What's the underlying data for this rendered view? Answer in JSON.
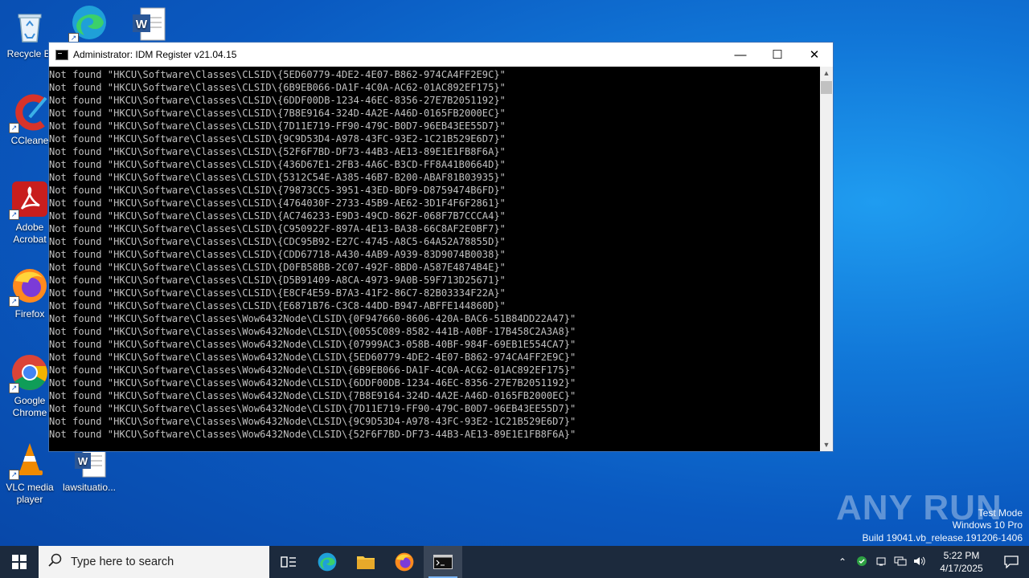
{
  "desktop": {
    "icons": [
      {
        "label": "Recycle Bin",
        "name": "recycle-bin"
      },
      {
        "label": "Microsoft Edge",
        "name": "edge"
      },
      {
        "label": "Word document",
        "name": "word-doc-top"
      },
      {
        "label": "CCleaner",
        "name": "ccleaner"
      },
      {
        "label": "Adobe Acrobat",
        "name": "adobe-acrobat"
      },
      {
        "label": "Firefox",
        "name": "firefox"
      },
      {
        "label": "Google Chrome",
        "name": "google-chrome"
      },
      {
        "label": "VLC media player",
        "name": "vlc"
      },
      {
        "label": "lawsituatio...",
        "name": "lawsituation-doc"
      }
    ]
  },
  "window": {
    "title": "Administrator:  IDM Register v21.04.15",
    "min_symbol": "—",
    "max_symbol": "☐",
    "close_symbol": "✕",
    "lines": [
      "Not found \"HKCU\\Software\\Classes\\CLSID\\{5ED60779-4DE2-4E07-B862-974CA4FF2E9C}\"",
      "Not found \"HKCU\\Software\\Classes\\CLSID\\{6B9EB066-DA1F-4C0A-AC62-01AC892EF175}\"",
      "Not found \"HKCU\\Software\\Classes\\CLSID\\{6DDF00DB-1234-46EC-8356-27E7B2051192}\"",
      "Not found \"HKCU\\Software\\Classes\\CLSID\\{7B8E9164-324D-4A2E-A46D-0165FB2000EC}\"",
      "Not found \"HKCU\\Software\\Classes\\CLSID\\{7D11E719-FF90-479C-B0D7-96EB43EE55D7}\"",
      "Not found \"HKCU\\Software\\Classes\\CLSID\\{9C9D53D4-A978-43FC-93E2-1C21B529E6D7}\"",
      "Not found \"HKCU\\Software\\Classes\\CLSID\\{52F6F7BD-DF73-44B3-AE13-89E1E1FB8F6A}\"",
      "Not found \"HKCU\\Software\\Classes\\CLSID\\{436D67E1-2FB3-4A6C-B3CD-FF8A41B0664D}\"",
      "Not found \"HKCU\\Software\\Classes\\CLSID\\{5312C54E-A385-46B7-B200-ABAF81B03935}\"",
      "Not found \"HKCU\\Software\\Classes\\CLSID\\{79873CC5-3951-43ED-BDF9-D8759474B6FD}\"",
      "Not found \"HKCU\\Software\\Classes\\CLSID\\{4764030F-2733-45B9-AE62-3D1F4F6F2861}\"",
      "Not found \"HKCU\\Software\\Classes\\CLSID\\{AC746233-E9D3-49CD-862F-068F7B7CCCA4}\"",
      "Not found \"HKCU\\Software\\Classes\\CLSID\\{C950922F-897A-4E13-BA38-66C8AF2E0BF7}\"",
      "Not found \"HKCU\\Software\\Classes\\CLSID\\{CDC95B92-E27C-4745-A8C5-64A52A78855D}\"",
      "Not found \"HKCU\\Software\\Classes\\CLSID\\{CDD67718-A430-4AB9-A939-83D9074B0038}\"",
      "Not found \"HKCU\\Software\\Classes\\CLSID\\{D0FB58BB-2C07-492F-8BD0-A587E4874B4E}\"",
      "Not found \"HKCU\\Software\\Classes\\CLSID\\{D5B91409-A8CA-4973-9A0B-59F713D25671}\"",
      "Not found \"HKCU\\Software\\Classes\\CLSID\\{E8CF4E59-B7A3-41F2-86C7-82B03334F22A}\"",
      "Not found \"HKCU\\Software\\Classes\\CLSID\\{E6871B76-C3C8-44DD-B947-ABFFE144860D}\"",
      "Not found \"HKCU\\Software\\Classes\\Wow6432Node\\CLSID\\{0F947660-8606-420A-BAC6-51B84DD22A47}\"",
      "Not found \"HKCU\\Software\\Classes\\Wow6432Node\\CLSID\\{0055C089-8582-441B-A0BF-17B458C2A3A8}\"",
      "Not found \"HKCU\\Software\\Classes\\Wow6432Node\\CLSID\\{07999AC3-058B-40BF-984F-69EB1E554CA7}\"",
      "Not found \"HKCU\\Software\\Classes\\Wow6432Node\\CLSID\\{5ED60779-4DE2-4E07-B862-974CA4FF2E9C}\"",
      "Not found \"HKCU\\Software\\Classes\\Wow6432Node\\CLSID\\{6B9EB066-DA1F-4C0A-AC62-01AC892EF175}\"",
      "Not found \"HKCU\\Software\\Classes\\Wow6432Node\\CLSID\\{6DDF00DB-1234-46EC-8356-27E7B2051192}\"",
      "Not found \"HKCU\\Software\\Classes\\Wow6432Node\\CLSID\\{7B8E9164-324D-4A2E-A46D-0165FB2000EC}\"",
      "Not found \"HKCU\\Software\\Classes\\Wow6432Node\\CLSID\\{7D11E719-FF90-479C-B0D7-96EB43EE55D7}\"",
      "Not found \"HKCU\\Software\\Classes\\Wow6432Node\\CLSID\\{9C9D53D4-A978-43FC-93E2-1C21B529E6D7}\"",
      "Not found \"HKCU\\Software\\Classes\\Wow6432Node\\CLSID\\{52F6F7BD-DF73-44B3-AE13-89E1E1FB8F6A}\""
    ]
  },
  "watermark": {
    "brand": "ANY RUN",
    "mode": "Test Mode",
    "edition": "Windows 10 Pro",
    "build": "Build 19041.vb_release.191206-1406"
  },
  "taskbar": {
    "search_placeholder": "Type here to search",
    "time": "5:22 PM",
    "date": "4/17/2025"
  }
}
